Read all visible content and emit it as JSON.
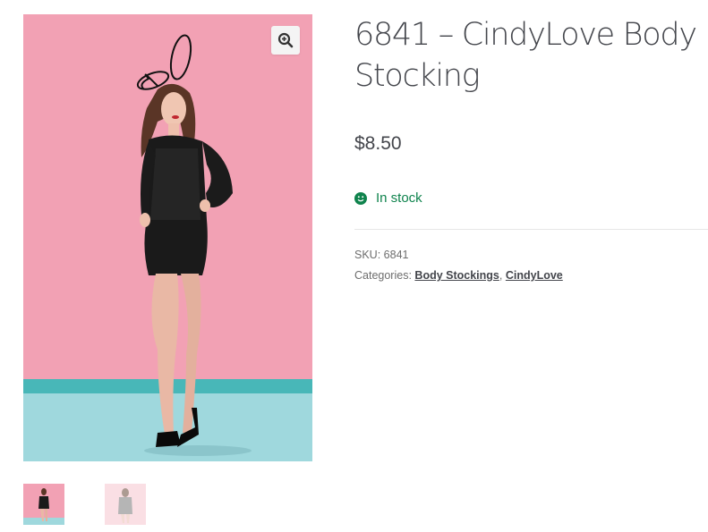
{
  "product": {
    "title": "6841 – CindyLove Body Stocking",
    "price": "$8.50",
    "stock_status": "In stock",
    "sku_label": "SKU:",
    "sku": "6841",
    "categories_label": "Categories:",
    "categories": [
      "Body Stockings",
      "CindyLove"
    ],
    "category_separator": ","
  },
  "gallery": {
    "zoom_icon": "magnifier-plus-icon",
    "thumbnail_count": 2,
    "background_color": "#f2a0b3"
  },
  "colors": {
    "stock_green": "#0f834d",
    "text": "#43454b"
  }
}
